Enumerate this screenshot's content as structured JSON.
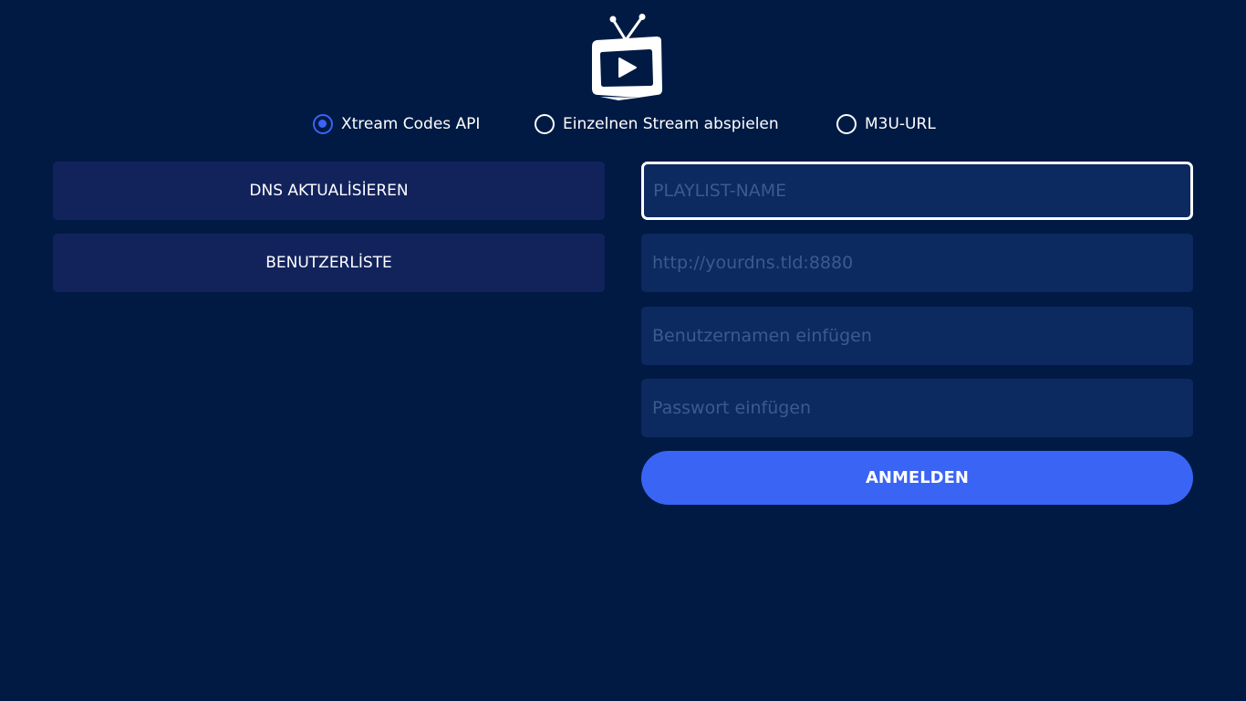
{
  "colors": {
    "background": "#001a44",
    "button_bg": "#12235c",
    "field_bg": "#0c2960",
    "accent": "#3a64f4",
    "placeholder": "#3d5a8c",
    "text": "#ffffff"
  },
  "logo": {
    "icon": "tv-play-icon"
  },
  "playlist_types": [
    {
      "label": "Xtream Codes API",
      "checked": true
    },
    {
      "label": "Einzelnen Stream abspielen",
      "checked": false
    },
    {
      "label": "M3U-URL",
      "checked": false
    }
  ],
  "left_panel": {
    "update_dns_label": "DNS AKTUALİSİEREN",
    "user_list_label": "BENUTZERLİSTE"
  },
  "form": {
    "playlist_name": {
      "value": "",
      "placeholder": "PLAYLIST-NAME"
    },
    "url": {
      "value": "",
      "placeholder": "http://yourdns.tld:8880"
    },
    "username": {
      "value": "",
      "placeholder": "Benutzernamen einfügen"
    },
    "password": {
      "value": "",
      "placeholder": "Passwort einfügen"
    },
    "login_label": "ANMELDEN"
  }
}
